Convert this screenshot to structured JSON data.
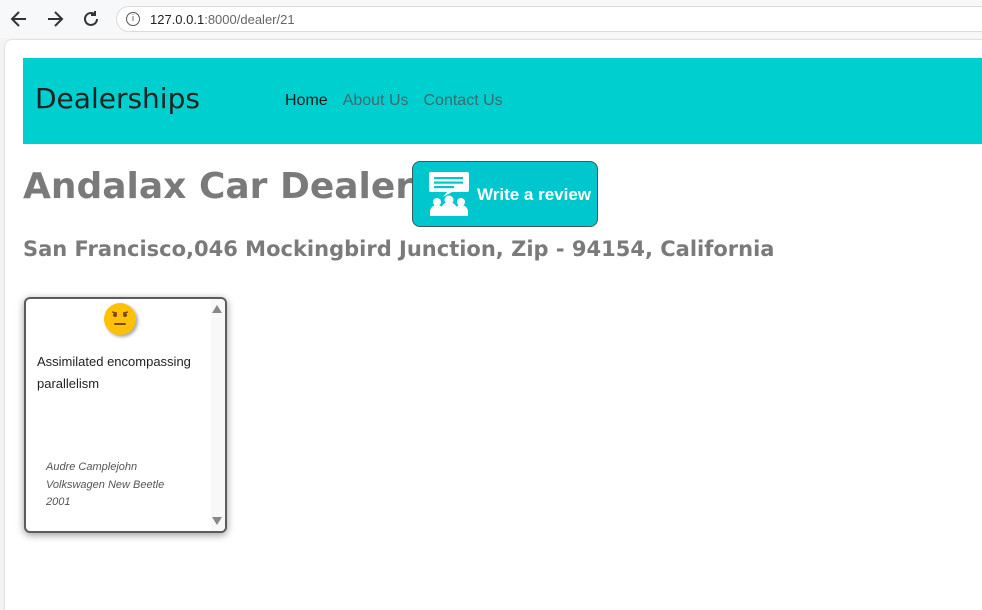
{
  "browser": {
    "url_host": "127.0.0.1",
    "url_rest": ":8000/dealer/21",
    "icons": {
      "back": "back-arrow-icon",
      "forward": "forward-arrow-icon",
      "reload": "reload-icon",
      "info": "info-icon"
    }
  },
  "nav": {
    "brand": "Dealerships",
    "links": [
      "Home",
      "About Us",
      "Contact Us"
    ],
    "active": "Home",
    "color": "#00cfd0"
  },
  "dealer": {
    "name": "Andalax Car Dealership",
    "address": "San Francisco,046 Mockingbird Junction, Zip - 94154, California"
  },
  "review_button": {
    "label": "Write a review",
    "icon": "review-people-icon"
  },
  "reviews": [
    {
      "sentiment_icon": "neutral-face-icon",
      "text": "Assimilated encompassing parallelism",
      "reviewer": "Audre Camplejohn",
      "car": "Volkswagen New Beetle",
      "year": "2001"
    }
  ]
}
